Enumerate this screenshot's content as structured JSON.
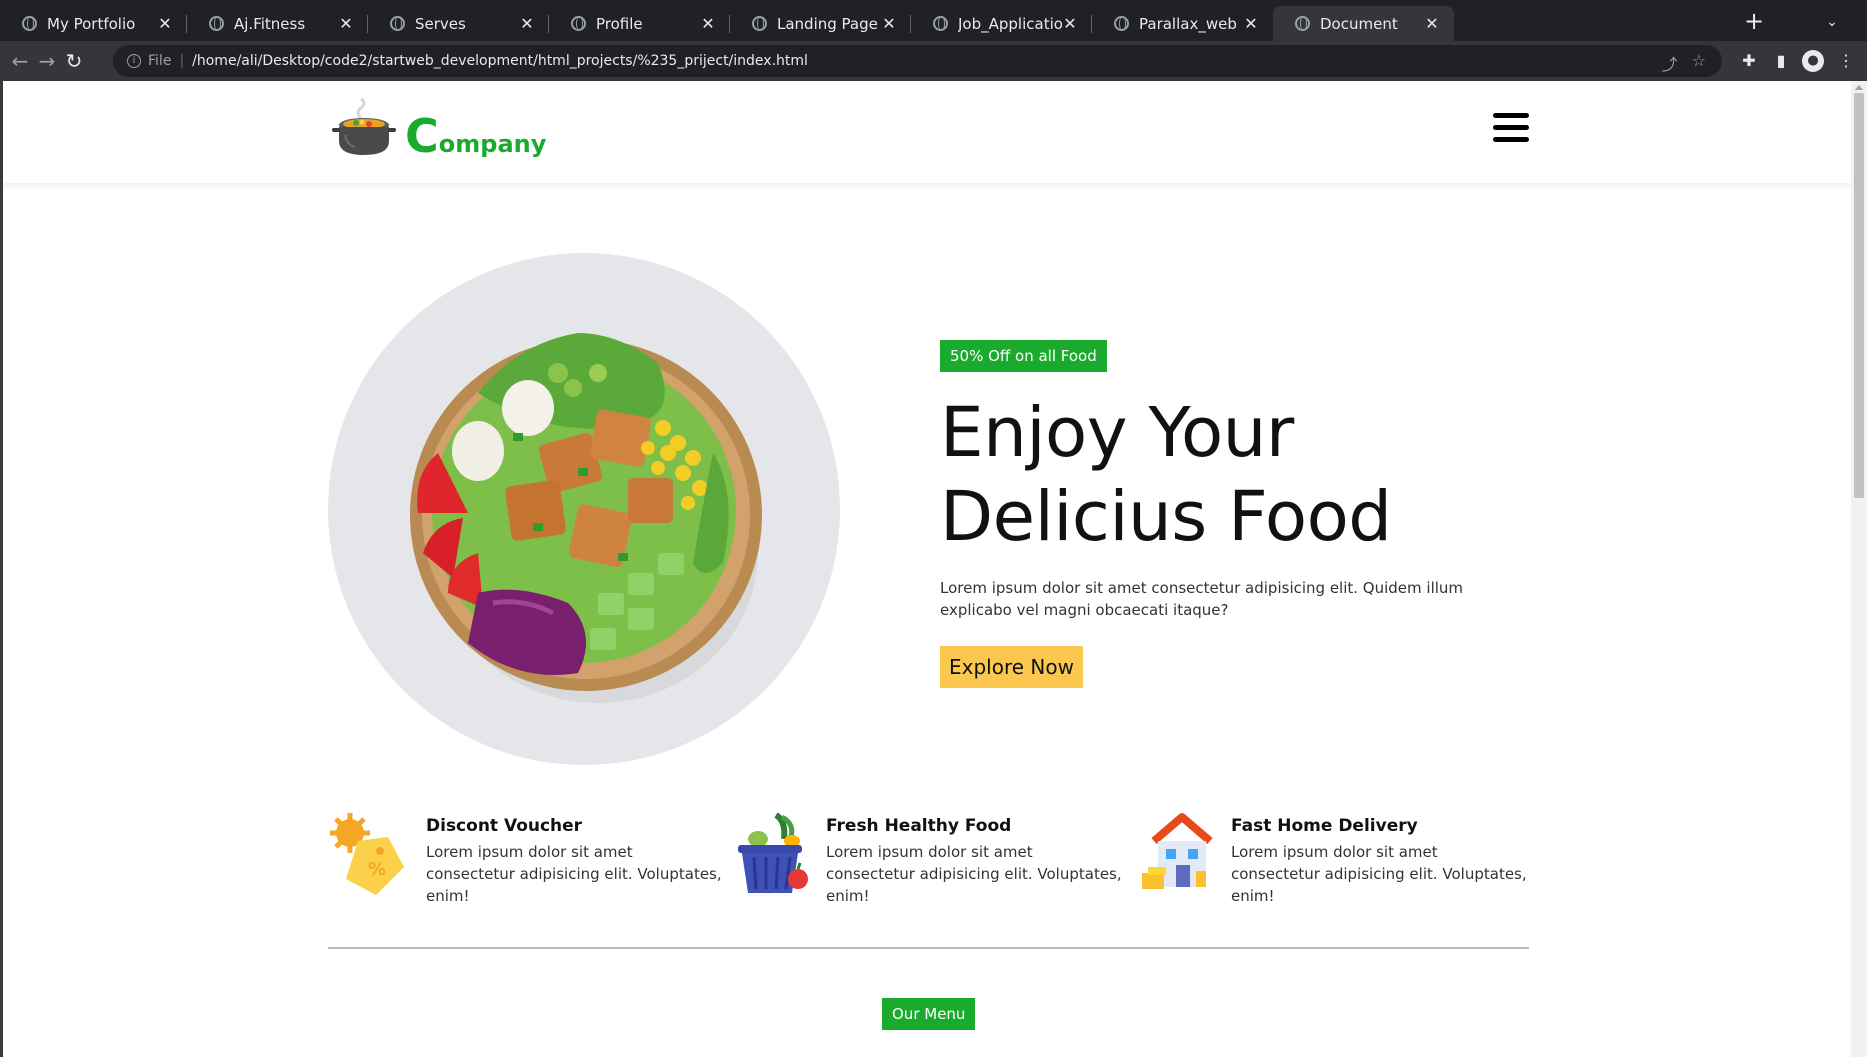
{
  "browser": {
    "tabs": [
      {
        "label": "My Portfolio",
        "active": false
      },
      {
        "label": "Aj.Fitness",
        "active": false
      },
      {
        "label": "Serves",
        "active": false
      },
      {
        "label": "Profile",
        "active": false
      },
      {
        "label": "Landing Page",
        "active": false
      },
      {
        "label": "Job_Application",
        "active": false
      },
      {
        "label": "Parallax_web",
        "active": false
      },
      {
        "label": "Document",
        "active": true
      }
    ],
    "omnibox": {
      "scheme_label": "File",
      "url": "/home/ali/Desktop/code2/startweb_development/html_projects/%235_priject/index.html"
    }
  },
  "page": {
    "brand": {
      "first_letter": "C",
      "rest": "ompany"
    },
    "hero": {
      "badge": "50% Off on all Food",
      "title_line1": "Enjoy Your",
      "title_line2": "Delicius Food",
      "description": "Lorem ipsum dolor sit amet consectetur adipisicing elit. Quidem illum explicabo vel magni obcaecati itaque?",
      "cta": "Explore Now"
    },
    "features": [
      {
        "title": "Discont Voucher",
        "description": "Lorem ipsum dolor sit amet consectetur adipisicing elit. Voluptates, enim!"
      },
      {
        "title": "Fresh Healthy Food",
        "description": "Lorem ipsum dolor sit amet consectetur adipisicing elit. Voluptates, enim!"
      },
      {
        "title": "Fast Home Delivery",
        "description": "Lorem ipsum dolor sit amet consectetur adipisicing elit. Voluptates, enim!"
      }
    ],
    "menu_badge": "Our Menu"
  },
  "colors": {
    "brand_green": "#1aab2e",
    "cta_yellow": "#fbc74f",
    "chrome_dark": "#202124",
    "chrome_toolbar": "#35363a"
  }
}
